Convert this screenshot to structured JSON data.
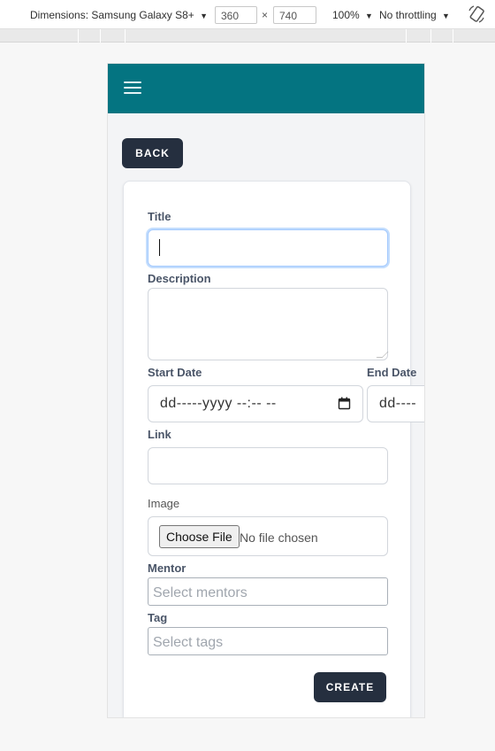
{
  "devtools": {
    "dimensions_label": "Dimensions: Samsung Galaxy S8+",
    "width": "360",
    "height": "740",
    "times": "×",
    "zoom": "100%",
    "throttling": "No throttling",
    "caret": "▼"
  },
  "app": {
    "theme_color": "#047481",
    "button_color": "#252f3f"
  },
  "nav": {
    "back_label": "BACK"
  },
  "form": {
    "title_label": "Title",
    "title_value": "",
    "description_label": "Description",
    "description_value": "",
    "start_date_label": "Start Date",
    "start_date_value": "dd-----yyyy --:-- --",
    "end_date_label": "End Date",
    "end_date_value": "dd----",
    "link_label": "Link",
    "link_value": "",
    "image_label": "Image",
    "choose_file_label": "Choose File",
    "no_file_text": "No file chosen",
    "mentor_label": "Mentor",
    "mentor_placeholder": "Select mentors",
    "tag_label": "Tag",
    "tag_placeholder": "Select tags",
    "create_label": "CREATE"
  }
}
